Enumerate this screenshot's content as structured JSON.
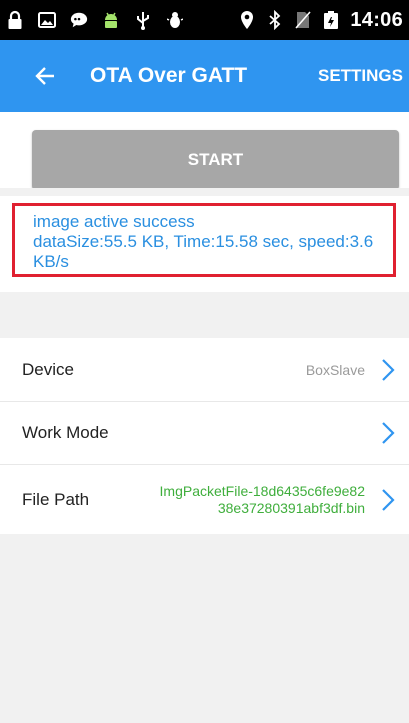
{
  "status_bar": {
    "time": "14:06",
    "left_icons": [
      "lock-icon",
      "image-icon",
      "messenger-icon",
      "android-icon",
      "usb-icon",
      "debug-bug-icon"
    ],
    "right_icons": [
      "location-icon",
      "bluetooth-icon",
      "no-sim-icon",
      "battery-icon"
    ]
  },
  "app_bar": {
    "title": "OTA Over GATT",
    "settings_label": "SETTINGS",
    "color": "#2f95f0"
  },
  "start_button": {
    "label": "START"
  },
  "status_message": {
    "line1": "image active success",
    "line2": "dataSize:55.5 KB, Time:15.58 sec, speed:3.6 KB/s"
  },
  "settings_list": {
    "device": {
      "label": "Device",
      "value": "BoxSlave"
    },
    "work_mode": {
      "label": "Work Mode",
      "value": ""
    },
    "file_path": {
      "label": "File Path",
      "value_line1": "ImgPacketFile-18d6435c6fe9e82",
      "value_line2": "38e37280391abf3df.bin"
    }
  }
}
